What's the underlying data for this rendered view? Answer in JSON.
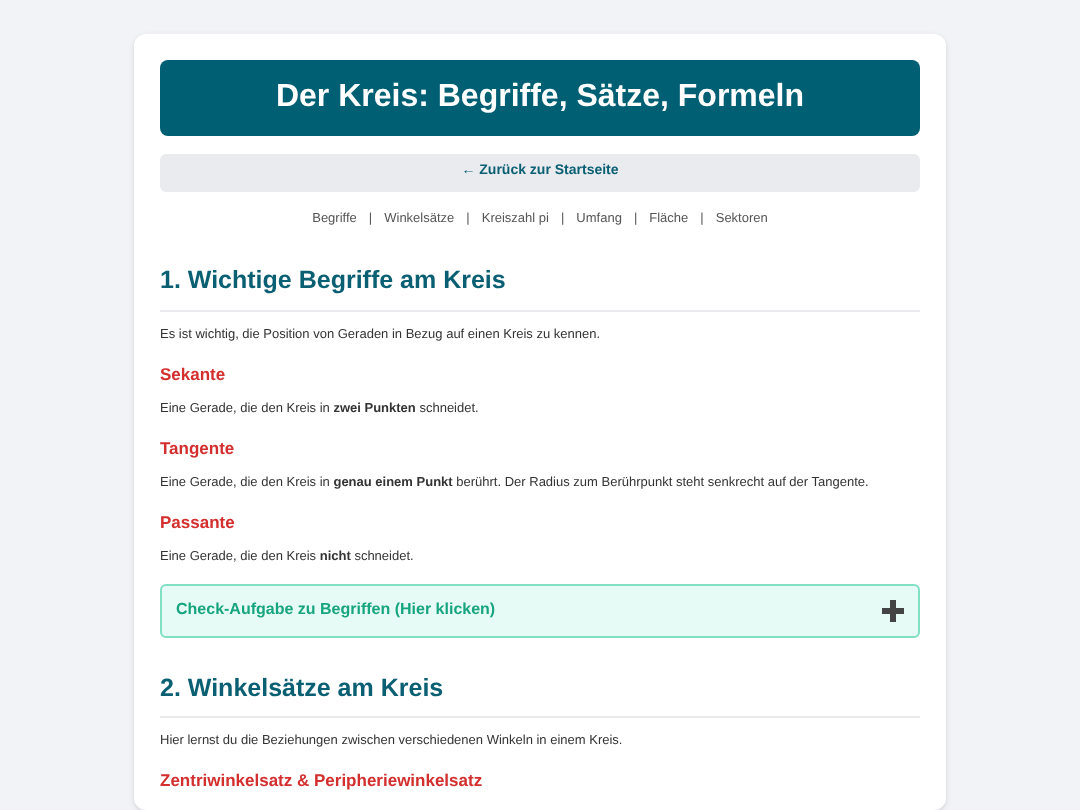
{
  "title": "Der Kreis: Begriffe, Sätze, Formeln",
  "back_link": "← Zurück zur Startseite",
  "nav": [
    {
      "label": "Begriffe",
      "separator": "|"
    },
    {
      "label": "Winkelsätze",
      "separator": "|"
    },
    {
      "label": "Kreiszahl pi",
      "separator": "|"
    },
    {
      "label": "Umfang",
      "separator": "|"
    },
    {
      "label": "Fläche",
      "separator": "|"
    },
    {
      "label": "Sektoren"
    }
  ],
  "content": [
    {
      "kind": "heading",
      "text": "1. Wichtige Begriffe am Kreis"
    },
    {
      "kind": "paragraph",
      "text": "Es ist wichtig, die Position von Geraden in Bezug auf einen Kreis zu kennen."
    },
    {
      "kind": "subheading",
      "text": "Sekante"
    },
    {
      "kind": "paragraph",
      "text": "Eine Gerade, die den Kreis in **zwei Punkten** schneidet."
    },
    {
      "kind": "subheading",
      "text": "Tangente"
    },
    {
      "kind": "paragraph",
      "text": "Eine Gerade, die den Kreis in **genau einem Punkt** berührt. Der Radius zum Berührpunkt steht senkrecht auf der Tangente."
    },
    {
      "kind": "subheading",
      "text": "Passante"
    },
    {
      "kind": "paragraph",
      "text": "Eine Gerade, die den Kreis **nicht** schneidet."
    },
    {
      "kind": "accordion",
      "text": "Check-Aufgabe zu Begriffen (Hier klicken)",
      "expanded": false
    },
    {
      "kind": "heading",
      "text": "2. Winkelsätze am Kreis"
    },
    {
      "kind": "paragraph",
      "text": "Hier lernst du die Beziehungen zwischen verschiedenen Winkeln in einem Kreis."
    },
    {
      "kind": "subheading",
      "text": "Zentriwinkelsatz & Peripheriewinkelsatz"
    }
  ]
}
